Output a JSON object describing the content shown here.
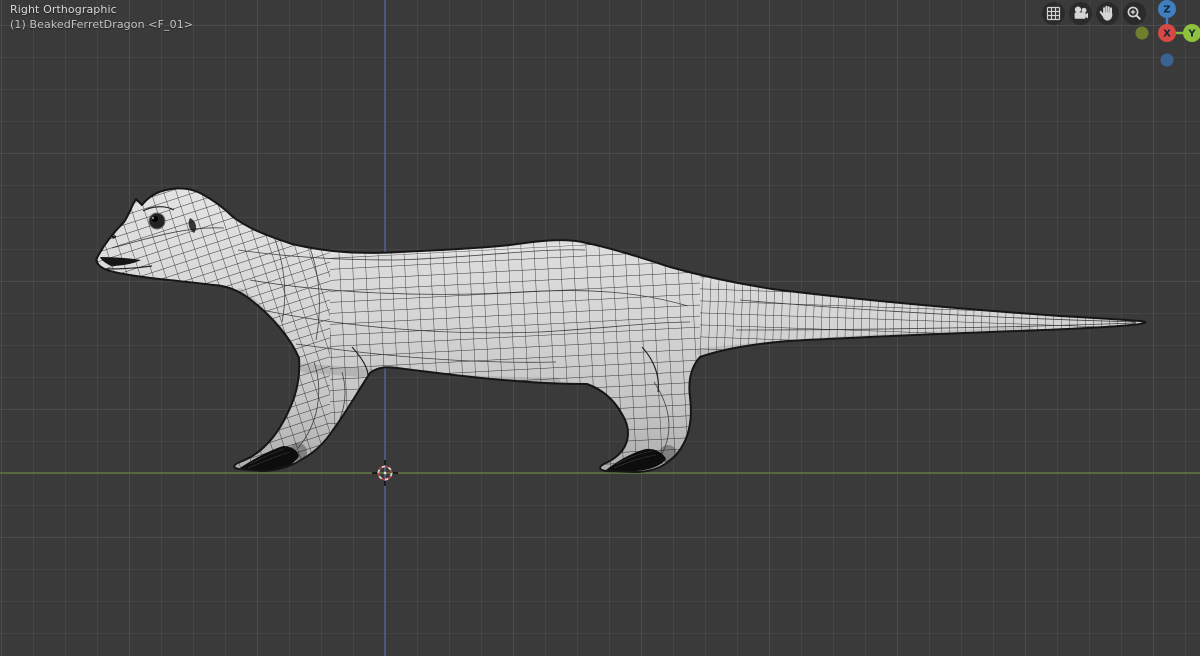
{
  "header": {
    "view_label": "Right Orthographic",
    "object_info": "(1) BeakedFerretDragon <F_01>"
  },
  "nav_controls": {
    "icons": [
      {
        "name": "grid-orthographic-icon",
        "glyph": "3x3-grid"
      },
      {
        "name": "camera-view-icon",
        "glyph": "movie-camera"
      },
      {
        "name": "pan-hand-icon",
        "glyph": "hand"
      },
      {
        "name": "zoom-icon",
        "glyph": "magnifier-plus"
      }
    ]
  },
  "gizmo": {
    "z_label": "Z",
    "x_label": "X",
    "y_label": "Y",
    "colors": {
      "x_axis": "#d64944",
      "y_axis": "#8fc13d",
      "z_axis": "#3f7fc0",
      "y_negative": "#6e7f2d",
      "z_negative": "#3a6292"
    }
  },
  "scene": {
    "model_name": "BeakedFerretDragon",
    "colors": {
      "background": "#3a3a3b",
      "grid_line": "#454546",
      "z_axis_line": "#4c6088",
      "ground_axis_line": "#5e7741",
      "mesh_fill": "#d6d6d6",
      "wireframe": "#2b2b2b",
      "cursor_red": "#b83d3d"
    }
  }
}
